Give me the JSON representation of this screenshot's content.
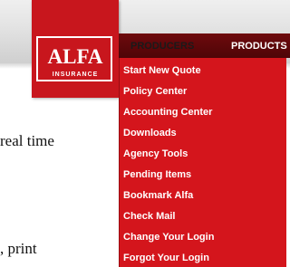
{
  "brand": {
    "logo_word": "ALFA",
    "logo_sub": "INSURANCE",
    "accent_red": "#d4151c",
    "nav_dark": "#5a0709"
  },
  "nav": {
    "producers": "PRODUCERS",
    "products": "PRODUCTS"
  },
  "menu": {
    "items": [
      "Start New Quote",
      "Policy Center",
      "Accounting Center",
      "Downloads",
      "Agency Tools",
      "Pending Items",
      "Bookmark Alfa",
      "Check Mail",
      "Change Your Login",
      "Forgot Your Login"
    ]
  },
  "page_text": {
    "line1": "real time",
    "line2": ", print"
  }
}
